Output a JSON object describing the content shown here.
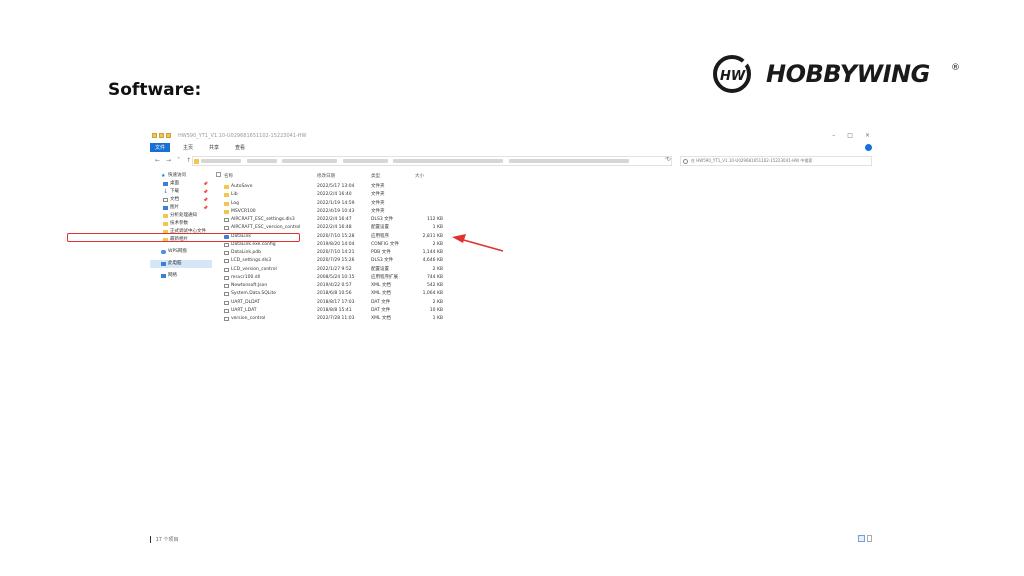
{
  "slide": {
    "title": "Software:"
  },
  "brand": {
    "logo_text": "HOBBYWING",
    "registered": "®",
    "emblem_text": "HW"
  },
  "window": {
    "title": "HW590_YT1_V1.10-U029681651102-15223041-HW",
    "controls": [
      "–",
      "□",
      "×"
    ],
    "ribbon_tabs": [
      "文件",
      "主页",
      "共享",
      "查看"
    ],
    "search_placeholder": "在 HW590_YT1_V1.10-U029681651102-15223041-HW 中搜索"
  },
  "sidebar": {
    "items": [
      {
        "label": "快速访问",
        "icon": "star-icon"
      },
      {
        "label": "桌面",
        "icon": "desktop-icon",
        "pin": "📌"
      },
      {
        "label": "下载",
        "icon": "download-icon",
        "pin": "📌"
      },
      {
        "label": "文档",
        "icon": "document-icon",
        "pin": "📌"
      },
      {
        "label": "图片",
        "icon": "picture-icon",
        "pin": "📌"
      },
      {
        "label": "分析处理通知",
        "icon": "folder-icon"
      },
      {
        "label": "技术参数",
        "icon": "folder-icon"
      },
      {
        "label": "正式调试中心文件",
        "icon": "folder-icon"
      },
      {
        "label": "最新相片",
        "icon": "folder-icon"
      },
      {
        "label": "WPS网盘",
        "icon": "cloud-icon"
      },
      {
        "label": "此电脑",
        "icon": "pc-icon",
        "selected": true
      },
      {
        "label": "网络",
        "icon": "network-icon"
      }
    ]
  },
  "columns": [
    "名称",
    "修改日期",
    "类型",
    "大小"
  ],
  "files": [
    {
      "name": "AutoSave",
      "date": "2022/5/17 13:04",
      "type": "文件夹",
      "size": "",
      "kind": "folder"
    },
    {
      "name": "Lib",
      "date": "2022/2/4 16:40",
      "type": "文件夹",
      "size": "",
      "kind": "folder"
    },
    {
      "name": "Log",
      "date": "2022/1/19 14:59",
      "type": "文件夹",
      "size": "",
      "kind": "folder"
    },
    {
      "name": "MSVCR100",
      "date": "2022/4/19 10:43",
      "type": "文件夹",
      "size": "",
      "kind": "folder"
    },
    {
      "name": "AIRCRAFT_ESC_settings.dls3",
      "date": "2022/2/4 16:47",
      "type": "DLS3 文件",
      "size": "112 KB",
      "kind": "file"
    },
    {
      "name": "AIRCRAFT_ESC_version_control",
      "date": "2022/2/4 16:48",
      "type": "配置设置",
      "size": "1 KB",
      "kind": "file"
    },
    {
      "name": "DataLink",
      "date": "2020/7/10 15:28",
      "type": "应用程序",
      "size": "2,811 KB",
      "kind": "app"
    },
    {
      "name": "DataLink.exe.config",
      "date": "2019/8/20 14:04",
      "type": "CONFIG 文件",
      "size": "2 KB",
      "kind": "file"
    },
    {
      "name": "DataLink.pdb",
      "date": "2020/7/10 14:21",
      "type": "PDB 文件",
      "size": "1,144 KB",
      "kind": "file"
    },
    {
      "name": "LCD_settings.dls3",
      "date": "2020/7/29 15:26",
      "type": "DLS3 文件",
      "size": "4,646 KB",
      "kind": "file"
    },
    {
      "name": "LCD_version_control",
      "date": "2022/1/27 9:52",
      "type": "配置设置",
      "size": "2 KB",
      "kind": "file"
    },
    {
      "name": "msvcr100.dll",
      "date": "2008/5/24 10:15",
      "type": "应用程序扩展",
      "size": "744 KB",
      "kind": "file"
    },
    {
      "name": "Newtonsoft.Json",
      "date": "2019/4/22 0:57",
      "type": "XML 文档",
      "size": "542 KB",
      "kind": "file"
    },
    {
      "name": "System.Data.SQLite",
      "date": "2018/6/8 10:56",
      "type": "XML 文档",
      "size": "1,064 KB",
      "kind": "file"
    },
    {
      "name": "UART_DLDAT",
      "date": "2018/8/17 17:03",
      "type": "DAT 文件",
      "size": "2 KB",
      "kind": "file"
    },
    {
      "name": "UART_LDAT",
      "date": "2018/8/8 15:41",
      "type": "DAT 文件",
      "size": "10 KB",
      "kind": "file"
    },
    {
      "name": "version_control",
      "date": "2022/7/28 11:03",
      "type": "XML 文档",
      "size": "1 KB",
      "kind": "file"
    }
  ],
  "status": {
    "item_count": "17 个项目"
  },
  "colors": {
    "highlight": "#e0312f",
    "accent": "#1a6fd4",
    "folder": "#f0c850"
  }
}
